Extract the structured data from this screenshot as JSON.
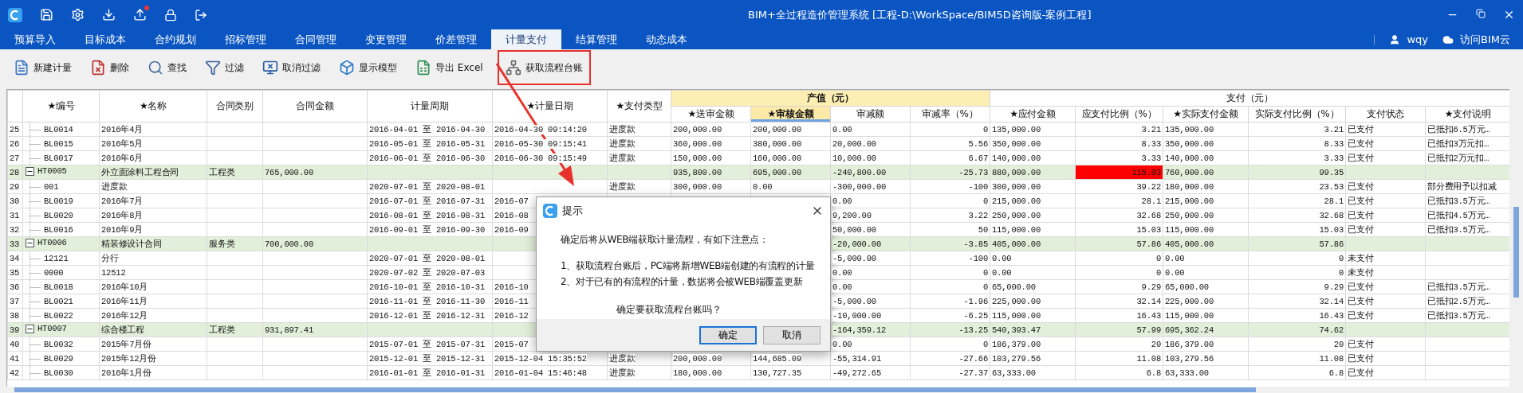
{
  "title_bar": {
    "title": "BIM+全过程造价管理系统 [工程-D:\\WorkSpace/BIM5D咨询版-案例工程]",
    "update_badge": true
  },
  "tabs": [
    {
      "label": "预算导入",
      "selected": false
    },
    {
      "label": "目标成本",
      "selected": false
    },
    {
      "label": "合约规划",
      "selected": false
    },
    {
      "label": "招标管理",
      "selected": false
    },
    {
      "label": "合同管理",
      "selected": false
    },
    {
      "label": "变更管理",
      "selected": false
    },
    {
      "label": "价差管理",
      "selected": false
    },
    {
      "label": "计量支付",
      "selected": true
    },
    {
      "label": "结算管理",
      "selected": false
    },
    {
      "label": "动态成本",
      "selected": false
    }
  ],
  "user": {
    "name": "wqy",
    "cloud_link": "访问BIM云"
  },
  "toolbar": [
    {
      "label": "新建计量",
      "highlighted": false
    },
    {
      "label": "删除",
      "highlighted": false
    },
    {
      "label": "查找",
      "highlighted": false
    },
    {
      "label": "过滤",
      "highlighted": false
    },
    {
      "label": "取消过滤",
      "highlighted": false
    },
    {
      "label": "显示模型",
      "highlighted": false
    },
    {
      "label": "导出 Excel",
      "highlighted": false
    },
    {
      "label": "获取流程台账",
      "highlighted": true
    }
  ],
  "table": {
    "columns": [
      {
        "label": "★编号",
        "selected": false
      },
      {
        "label": "★名称",
        "selected": false
      },
      {
        "label": "合同类别",
        "selected": false
      },
      {
        "label": "合同金额",
        "selected": false
      },
      {
        "label": "计量周期",
        "selected": false
      },
      {
        "label": "★计量日期",
        "selected": false
      },
      {
        "label": "★支付类型",
        "selected": false
      }
    ],
    "column_groups": [
      {
        "label": "产值（元）",
        "highlighted": true,
        "columns": [
          {
            "label": "★送审金额",
            "selected": false
          },
          {
            "label": "★审核金额",
            "selected": true
          },
          {
            "label": "审减额",
            "selected": false
          },
          {
            "label": "审减率（%）",
            "selected": false
          }
        ]
      },
      {
        "label": "支付（元）",
        "highlighted": false,
        "columns": [
          {
            "label": "★应付金额",
            "selected": false
          },
          {
            "label": "应支付比例（%）",
            "selected": false
          },
          {
            "label": "★实际支付金额",
            "selected": false
          },
          {
            "label": "实际支付比例（%）",
            "selected": false
          },
          {
            "label": "支付状态",
            "selected": false
          },
          {
            "label": "★支付说明",
            "selected": false
          }
        ]
      }
    ],
    "rows": [
      {
        "kind": "item",
        "alert": false,
        "num": "25",
        "code": "BL0014",
        "name": "2016年4月",
        "period": "2016-04-01 至 2016-04-30",
        "date": "2016-04-30 09:14:20",
        "pay_type": "进度款",
        "submitted": "200,000.00",
        "approved": "200,000.00",
        "reduction": "0.00",
        "reduction_rate": "0",
        "payable": "135,000.00",
        "payable_ratio": "3.21",
        "paid": "135,000.00",
        "paid_ratio": "3.21",
        "status": "已支付",
        "note": "已抵扣6.5万元…"
      },
      {
        "kind": "item",
        "alert": false,
        "num": "26",
        "code": "BL0015",
        "name": "2016年5月",
        "period": "2016-05-01 至 2016-05-31",
        "date": "2016-05-30 09:15:41",
        "pay_type": "进度款",
        "submitted": "360,000.00",
        "approved": "380,000.00",
        "reduction": "20,000.00",
        "reduction_rate": "5.56",
        "payable": "350,000.00",
        "payable_ratio": "8.33",
        "paid": "350,000.00",
        "paid_ratio": "8.33",
        "status": "已支付",
        "note": "已抵扣3万元扣…"
      },
      {
        "kind": "item",
        "alert": false,
        "num": "27",
        "code": "BL0017",
        "name": "2016年6月",
        "period": "2016-06-01 至 2016-06-30",
        "date": "2016-06-30 09:15:49",
        "pay_type": "进度款",
        "submitted": "150,000.00",
        "approved": "160,000.00",
        "reduction": "10,000.00",
        "reduction_rate": "6.67",
        "payable": "140,000.00",
        "payable_ratio": "3.33",
        "paid": "140,000.00",
        "paid_ratio": "3.33",
        "status": "已支付",
        "note": "已抵扣2万元扣…"
      },
      {
        "kind": "group",
        "expanded": true,
        "alert": true,
        "num": "28",
        "code": "HT0005",
        "name": "外立面涂料工程合同",
        "category": "工程类",
        "amount": "765,000.00",
        "submitted": "935,800.00",
        "approved": "695,000.00",
        "reduction": "-240,800.00",
        "reduction_rate": "-25.73",
        "payable": "880,000.00",
        "payable_ratio": "115.03",
        "paid": "760,000.00",
        "paid_ratio": "99.35"
      },
      {
        "kind": "item",
        "alert": false,
        "num": "29",
        "code": "001",
        "name": "进度款",
        "period": "2020-07-01 至 2020-08-01",
        "pay_type": "进度款",
        "submitted": "300,000.00",
        "approved": "0.00",
        "reduction": "-300,000.00",
        "reduction_rate": "-100",
        "payable": "300,000.00",
        "payable_ratio": "39.22",
        "paid": "180,000.00",
        "paid_ratio": "23.53",
        "status": "已支付",
        "note": "部分费用予以扣减"
      },
      {
        "kind": "item",
        "alert": false,
        "num": "30",
        "code": "BL0019",
        "name": "2016年7月",
        "period": "2016-07-01 至 2016-07-31",
        "date": "2016-07",
        "reduction": "0.00",
        "reduction_rate": "0",
        "payable": "215,000.00",
        "payable_ratio": "28.1",
        "paid": "215,000.00",
        "paid_ratio": "28.1",
        "status": "已支付",
        "note": "已抵扣3.5万元…"
      },
      {
        "kind": "item",
        "alert": false,
        "num": "31",
        "code": "BL0020",
        "name": "2016年8月",
        "period": "2016-08-01 至 2016-08-31",
        "date": "2016-08",
        "reduction": "9,200.00",
        "reduction_rate": "3.22",
        "payable": "250,000.00",
        "payable_ratio": "32.68",
        "paid": "250,000.00",
        "paid_ratio": "32.68",
        "status": "已支付",
        "note": "已抵扣4.5万元…"
      },
      {
        "kind": "item",
        "alert": false,
        "num": "32",
        "code": "BL0016",
        "name": "2016年9月",
        "period": "2016-09-01 至 2016-09-30",
        "date": "2016-09",
        "reduction": "50,000.00",
        "reduction_rate": "50",
        "payable": "115,000.00",
        "payable_ratio": "15.03",
        "paid": "115,000.00",
        "paid_ratio": "15.03",
        "status": "已支付",
        "note": "已抵扣3.5万元…"
      },
      {
        "kind": "group",
        "expanded": true,
        "alert": false,
        "num": "33",
        "code": "HT0006",
        "name": "精装修设计合同",
        "category": "服务类",
        "amount": "700,000.00",
        "reduction": "-20,000.00",
        "reduction_rate": "-3.85",
        "payable": "405,000.00",
        "payable_ratio": "57.86",
        "paid": "405,000.00",
        "paid_ratio": "57.86"
      },
      {
        "kind": "item",
        "alert": false,
        "num": "34",
        "code": "12121",
        "name": "分行",
        "period": "2020-07-01 至 2020-08-01",
        "reduction": "-5,000.00",
        "reduction_rate": "-100",
        "payable": "0.00",
        "payable_ratio": "0",
        "paid": "0.00",
        "paid_ratio": "0",
        "status": "未支付"
      },
      {
        "kind": "item",
        "alert": false,
        "num": "35",
        "code": "0000",
        "name": "12512",
        "period": "2020-07-02 至 2020-07-03",
        "reduction": "0.00",
        "reduction_rate": "0",
        "payable": "0.00",
        "payable_ratio": "0",
        "paid": "0.00",
        "paid_ratio": "0",
        "status": "未支付"
      },
      {
        "kind": "item",
        "alert": false,
        "num": "36",
        "code": "BL0018",
        "name": "2016年10月",
        "period": "2016-10-01 至 2016-10-31",
        "date": "2016-10",
        "reduction": "0.00",
        "reduction_rate": "0",
        "payable": "65,000.00",
        "payable_ratio": "9.29",
        "paid": "65,000.00",
        "paid_ratio": "9.29",
        "status": "已支付",
        "note": "已抵扣3.5万元…"
      },
      {
        "kind": "item",
        "alert": false,
        "num": "37",
        "code": "BL0021",
        "name": "2016年11月",
        "period": "2016-11-01 至 2016-11-30",
        "date": "2016-11",
        "reduction": "-5,000.00",
        "reduction_rate": "-1.96",
        "payable": "225,000.00",
        "payable_ratio": "32.14",
        "paid": "225,000.00",
        "paid_ratio": "32.14",
        "status": "已支付",
        "note": "已抵扣2.5万元…"
      },
      {
        "kind": "item",
        "alert": false,
        "num": "38",
        "code": "BL0022",
        "name": "2016年12月",
        "period": "2016-12-01 至 2016-12-31",
        "date": "2016-12",
        "reduction": "-10,000.00",
        "reduction_rate": "-6.25",
        "payable": "115,000.00",
        "payable_ratio": "16.43",
        "paid": "115,000.00",
        "paid_ratio": "16.43",
        "status": "已支付",
        "note": "已抵扣3.5万元…"
      },
      {
        "kind": "group",
        "expanded": true,
        "alert": false,
        "num": "39",
        "code": "HT0007",
        "name": "综合楼工程",
        "category": "工程类",
        "amount": "931,897.41",
        "reduction": "-164,359.12",
        "reduction_rate": "-13.25",
        "payable": "540,393.47",
        "payable_ratio": "57.99",
        "paid": "695,362.24",
        "paid_ratio": "74.62"
      },
      {
        "kind": "item",
        "alert": false,
        "num": "40",
        "code": "BL0032",
        "name": "2015年7月份",
        "period": "2015-07-01 至 2015-07-31",
        "date": "2015-07",
        "reduction": "0.00",
        "reduction_rate": "0",
        "payable": "186,379.00",
        "payable_ratio": "20",
        "paid": "186,379.00",
        "paid_ratio": "20",
        "status": "已支付"
      },
      {
        "kind": "item",
        "alert": false,
        "num": "41",
        "code": "BL0029",
        "name": "2015年12月份",
        "period": "2015-12-01 至 2015-12-31",
        "date": "2015-12-04 15:35:52",
        "pay_type": "进度款",
        "submitted": "200,000.00",
        "approved": "144,685.09",
        "reduction": "-55,314.91",
        "reduction_rate": "-27.66",
        "payable": "103,279.56",
        "payable_ratio": "11.08",
        "paid": "103,279.56",
        "paid_ratio": "11.08",
        "status": "已支付"
      },
      {
        "kind": "item",
        "alert": false,
        "num": "42",
        "code": "BL0030",
        "name": "2016年1月份",
        "period": "2016-01-01 至 2016-01-31",
        "date": "2016-01-04 15:46:48",
        "pay_type": "进度款",
        "submitted": "180,000.00",
        "approved": "130,727.35",
        "reduction": "-49,272.65",
        "reduction_rate": "-27.37",
        "payable": "63,333.00",
        "payable_ratio": "6.8",
        "paid": "63,333.00",
        "paid_ratio": "6.8",
        "status": "已支付"
      }
    ]
  },
  "dialog": {
    "title": "提示",
    "lines": [
      "确定后将从WEB端获取计量流程，有如下注意点：",
      "1、获取流程台账后，PC端将新增WEB端创建的有流程的计量",
      "2、对于已有的有流程的计量，数据将会被WEB端覆盖更新"
    ],
    "question": "确定要获取流程台账吗？",
    "buttons": [
      {
        "label": "确定",
        "default": true
      },
      {
        "label": "取消",
        "default": false
      }
    ]
  }
}
